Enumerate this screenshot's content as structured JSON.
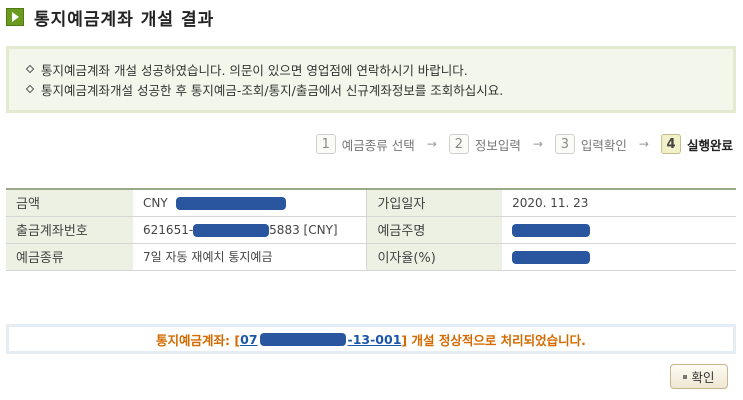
{
  "header": {
    "title": "통지예금계좌 개설 결과",
    "icon": "play-arrow-icon",
    "icon_color": "#6a9a1f"
  },
  "notice": {
    "lines": [
      "통지예금계좌 개설 성공하였습니다. 의문이 있으면 영업점에 연락하시기 바랍니다.",
      "통지예금계좌개설 성공한 후 통지예금-조회/통지/출금에서 신규계좌정보를 조회하십시요."
    ]
  },
  "steps": {
    "items": [
      {
        "num": "1",
        "label": "예금종류 선택"
      },
      {
        "num": "2",
        "label": "정보입력"
      },
      {
        "num": "3",
        "label": "입력확인"
      },
      {
        "num": "4",
        "label": "실행완료"
      }
    ],
    "arrow": "→",
    "active_index": 3
  },
  "info": {
    "amount_label": "금액",
    "amount_value_prefix": "CNY",
    "join_date_label": "가입일자",
    "join_date_value": "2020. 11. 23",
    "withdraw_account_label": "출금계좌번호",
    "withdraw_account_prefix": "621651-",
    "withdraw_account_suffix": "5883 [CNY]",
    "depositor_label": "예금주명",
    "deposit_type_label": "예금종류",
    "deposit_type_value": "7일 자동 재예치 통지예금",
    "interest_rate_label": "이자율(%)"
  },
  "result": {
    "prefix": "통지예금계좌: [",
    "account_start": "07",
    "account_end": "-13-001",
    "suffix": "] 개설 정상적으로 처리되었습니다.",
    "color": "#d36a00",
    "link_color": "#1c56a8"
  },
  "buttons": {
    "confirm_label": "확인"
  },
  "colors": {
    "redaction": "#2a56a0",
    "table_label_bg": "#ecf1e3",
    "notice_bg": "#f3f6ea"
  }
}
